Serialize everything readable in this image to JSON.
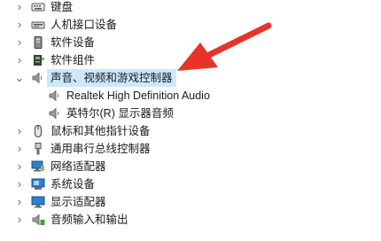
{
  "tree": {
    "items": [
      {
        "label": "键盘",
        "icon": "keyboard-icon",
        "expander": "›"
      },
      {
        "label": "人机接口设备",
        "icon": "hid-icon",
        "expander": "›"
      },
      {
        "label": "软件设备",
        "icon": "software-device-icon",
        "expander": "›"
      },
      {
        "label": "软件组件",
        "icon": "software-component-icon",
        "expander": "›"
      },
      {
        "label": "声音、视频和游戏控制器",
        "icon": "speaker-icon",
        "expander": "⌄",
        "selected": true
      },
      {
        "label": "Realtek High Definition Audio",
        "icon": "speaker-icon",
        "child": true
      },
      {
        "label": "英特尔(R) 显示器音频",
        "icon": "speaker-icon",
        "child": true
      },
      {
        "label": "鼠标和其他指针设备",
        "icon": "mouse-icon",
        "expander": "›"
      },
      {
        "label": "通用串行总线控制器",
        "icon": "usb-icon",
        "expander": "›"
      },
      {
        "label": "网络适配器",
        "icon": "network-icon",
        "expander": "›"
      },
      {
        "label": "系统设备",
        "icon": "system-device-icon",
        "expander": "›"
      },
      {
        "label": "显示适配器",
        "icon": "display-adapter-icon",
        "expander": "›"
      },
      {
        "label": "音频输入和输出",
        "icon": "audio-io-icon",
        "expander": "›"
      }
    ]
  },
  "colors": {
    "selection": "#cce8ff",
    "annotation_arrow": "#e8332a"
  }
}
